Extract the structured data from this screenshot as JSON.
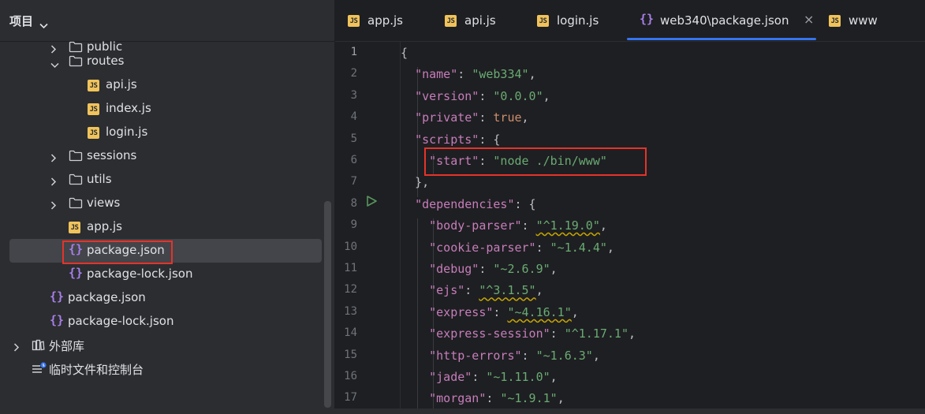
{
  "project": {
    "title": "项目",
    "tree": [
      {
        "label": "public",
        "kind": "folder",
        "indent": 1,
        "arrow": "right",
        "partial": true
      },
      {
        "label": "routes",
        "kind": "folder",
        "indent": 1,
        "arrow": "down"
      },
      {
        "label": "api.js",
        "kind": "js",
        "indent": 2
      },
      {
        "label": "index.js",
        "kind": "js",
        "indent": 2
      },
      {
        "label": "login.js",
        "kind": "js",
        "indent": 2
      },
      {
        "label": "sessions",
        "kind": "folder",
        "indent": 1,
        "arrow": "right"
      },
      {
        "label": "utils",
        "kind": "folder",
        "indent": 1,
        "arrow": "right"
      },
      {
        "label": "views",
        "kind": "folder",
        "indent": 1,
        "arrow": "right"
      },
      {
        "label": "app.js",
        "kind": "js",
        "indent": 1
      },
      {
        "label": "package.json",
        "kind": "json",
        "indent": 1,
        "selected": true
      },
      {
        "label": "package-lock.json",
        "kind": "json",
        "indent": 1
      },
      {
        "label": "package.json",
        "kind": "json",
        "indent": 0
      },
      {
        "label": "package-lock.json",
        "kind": "json",
        "indent": 0
      },
      {
        "label": "外部库",
        "kind": "library",
        "indent": -1,
        "arrow": "right"
      },
      {
        "label": "临时文件和控制台",
        "kind": "scratch",
        "indent": -1
      }
    ]
  },
  "tabs": [
    {
      "label": "app.js",
      "kind": "js"
    },
    {
      "label": "api.js",
      "kind": "js"
    },
    {
      "label": "login.js",
      "kind": "js"
    },
    {
      "label": "web340\\package.json",
      "kind": "json",
      "active": true,
      "close": "×"
    },
    {
      "label": "www",
      "kind": "js"
    }
  ],
  "editor": {
    "line_numbers": [
      "1",
      "2",
      "3",
      "4",
      "5",
      "6",
      "7",
      "8",
      "9",
      "10",
      "11",
      "12",
      "13",
      "14",
      "15",
      "16",
      "17"
    ],
    "current_line": 1,
    "run_line": 6,
    "lines": [
      [
        {
          "t": "{",
          "c": "p"
        }
      ],
      [
        {
          "t": "  "
        },
        {
          "t": "\"name\"",
          "c": "k"
        },
        {
          "t": ": ",
          "c": "p"
        },
        {
          "t": "\"web334\"",
          "c": "s"
        },
        {
          "t": ",",
          "c": "p"
        }
      ],
      [
        {
          "t": "  "
        },
        {
          "t": "\"version\"",
          "c": "k"
        },
        {
          "t": ": ",
          "c": "p"
        },
        {
          "t": "\"0.0.0\"",
          "c": "s"
        },
        {
          "t": ",",
          "c": "p"
        }
      ],
      [
        {
          "t": "  "
        },
        {
          "t": "\"private\"",
          "c": "k"
        },
        {
          "t": ": ",
          "c": "p"
        },
        {
          "t": "true",
          "c": "b"
        },
        {
          "t": ",",
          "c": "p"
        }
      ],
      [
        {
          "t": "  "
        },
        {
          "t": "\"scripts\"",
          "c": "k"
        },
        {
          "t": ": {",
          "c": "p"
        }
      ],
      [
        {
          "t": "    "
        },
        {
          "t": "\"start\"",
          "c": "k"
        },
        {
          "t": ": ",
          "c": "p"
        },
        {
          "t": "\"node ./bin/www\"",
          "c": "s"
        }
      ],
      [
        {
          "t": "  "
        },
        {
          "t": "},",
          "c": "p"
        }
      ],
      [
        {
          "t": "  "
        },
        {
          "t": "\"dependencies\"",
          "c": "k"
        },
        {
          "t": ": {",
          "c": "p"
        }
      ],
      [
        {
          "t": "    "
        },
        {
          "t": "\"body-parser\"",
          "c": "k"
        },
        {
          "t": ": ",
          "c": "p"
        },
        {
          "t": "\"^1.19.0\"",
          "c": "s",
          "w": true
        },
        {
          "t": ",",
          "c": "p"
        }
      ],
      [
        {
          "t": "    "
        },
        {
          "t": "\"cookie-parser\"",
          "c": "k"
        },
        {
          "t": ": ",
          "c": "p"
        },
        {
          "t": "\"~1.4.4\"",
          "c": "s"
        },
        {
          "t": ",",
          "c": "p"
        }
      ],
      [
        {
          "t": "    "
        },
        {
          "t": "\"debug\"",
          "c": "k"
        },
        {
          "t": ": ",
          "c": "p"
        },
        {
          "t": "\"~2.6.9\"",
          "c": "s"
        },
        {
          "t": ",",
          "c": "p"
        }
      ],
      [
        {
          "t": "    "
        },
        {
          "t": "\"ejs\"",
          "c": "k"
        },
        {
          "t": ": ",
          "c": "p"
        },
        {
          "t": "\"^3.1.5\"",
          "c": "s",
          "w": true
        },
        {
          "t": ",",
          "c": "p"
        }
      ],
      [
        {
          "t": "    "
        },
        {
          "t": "\"express\"",
          "c": "k"
        },
        {
          "t": ": ",
          "c": "p"
        },
        {
          "t": "\"~4.16.1\"",
          "c": "s",
          "w": true
        },
        {
          "t": ",",
          "c": "p"
        }
      ],
      [
        {
          "t": "    "
        },
        {
          "t": "\"express-session\"",
          "c": "k"
        },
        {
          "t": ": ",
          "c": "p"
        },
        {
          "t": "\"^1.17.1\"",
          "c": "s"
        },
        {
          "t": ",",
          "c": "p"
        }
      ],
      [
        {
          "t": "    "
        },
        {
          "t": "\"http-errors\"",
          "c": "k"
        },
        {
          "t": ": ",
          "c": "p"
        },
        {
          "t": "\"~1.6.3\"",
          "c": "s"
        },
        {
          "t": ",",
          "c": "p"
        }
      ],
      [
        {
          "t": "    "
        },
        {
          "t": "\"jade\"",
          "c": "k"
        },
        {
          "t": ": ",
          "c": "p"
        },
        {
          "t": "\"~1.11.0\"",
          "c": "s"
        },
        {
          "t": ",",
          "c": "p"
        }
      ],
      [
        {
          "t": "    "
        },
        {
          "t": "\"morgan\"",
          "c": "k"
        },
        {
          "t": ": ",
          "c": "p"
        },
        {
          "t": "\"~1.9.1\"",
          "c": "s"
        },
        {
          "t": ",",
          "c": "p"
        }
      ]
    ]
  },
  "colors": {
    "key": "#c77dbb",
    "string": "#6aab73",
    "keyword": "#cf8e6d",
    "highlight_box": "#e5332a",
    "active_tab": "#3574f0"
  }
}
